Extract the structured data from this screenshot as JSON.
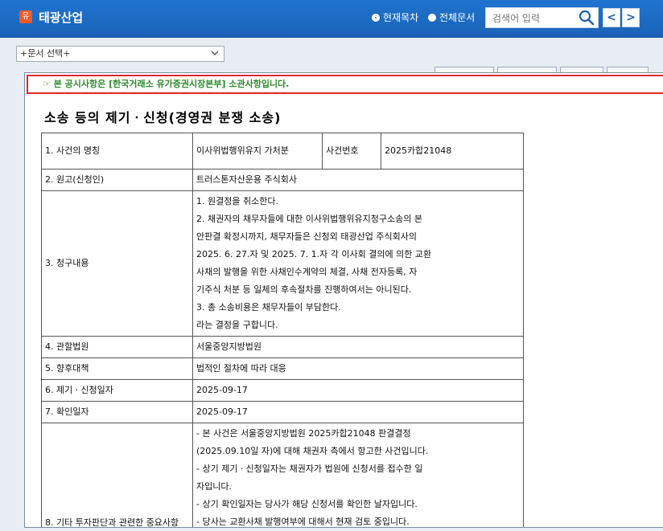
{
  "header": {
    "logo_text": "유",
    "app_title": "태광산업",
    "radio_current": "현재목차",
    "radio_all": "전체문서",
    "search_placeholder": "검색어 입력",
    "prev": "<",
    "next": ">"
  },
  "doc_select": {
    "value": "+문서 선택+"
  },
  "notice": "☞ 본 공시사항은 [한국거래소 유가증권시장본부] 소관사항입니다.",
  "title": "소송 등의 제기ㆍ신청(경영권 분쟁 소송)",
  "rows": {
    "r1": {
      "label": "1. 사건의 명칭",
      "value": "이사위법행위유지 가처분",
      "sub_label": "사건번호",
      "sub_value": "2025카합21048"
    },
    "r2": {
      "label": "2. 원고(신청인)",
      "value": "트러스톤자산운용 주식회사"
    },
    "r3": {
      "label": "3. 청구내용",
      "lines": [
        "1. 원결정을 취소한다.",
        "2. 채권자의 채무자들에 대한 이사위법행위유지청구소송의 본",
        "안판결 확정시까지, 채무자들은 신청외 태광산업 주식회사의",
        "2025. 6. 27.자 및 2025. 7. 1.자 각 이사회 결의에 의한 교환",
        "사채의 발행을 위한 사채인수계약의 체결, 사채 전자등록, 자",
        "기주식 처분 등 일체의 후속절차를 진행하여서는 아니된다.",
        "3. 총 소송비용은 채무자들이 부담한다.",
        "라는 결정을 구합니다."
      ]
    },
    "r4": {
      "label": "4. 관할법원",
      "value": "서울중앙지방법원"
    },
    "r5": {
      "label": "5. 향후대책",
      "value": "법적인 절차에 따라 대응"
    },
    "r6": {
      "label": "6. 제기ㆍ신청일자",
      "value": "2025-09-17"
    },
    "r7": {
      "label": "7. 확인일자",
      "value": "2025-09-17"
    },
    "r8": {
      "label": "8. 기타 투자판단과 관련한 중요사항",
      "lines": [
        "- 본 사건은 서울중앙지방법원 2025카합21048 판결결정",
        "(2025.09.10일 자)에 대해 채권자 측에서 항고한 사건입니다.",
        "- 상기 제기ㆍ신청일자는 채권자가 법원에 신청서를 접수한 일",
        "자입니다.",
        "- 상기 확인일자는 당사가 해당 신청서를 확인한 날자입니다.",
        "- 당사는 교환사채 발행여부에 대해서 현재 검토 중입니다."
      ]
    }
  }
}
